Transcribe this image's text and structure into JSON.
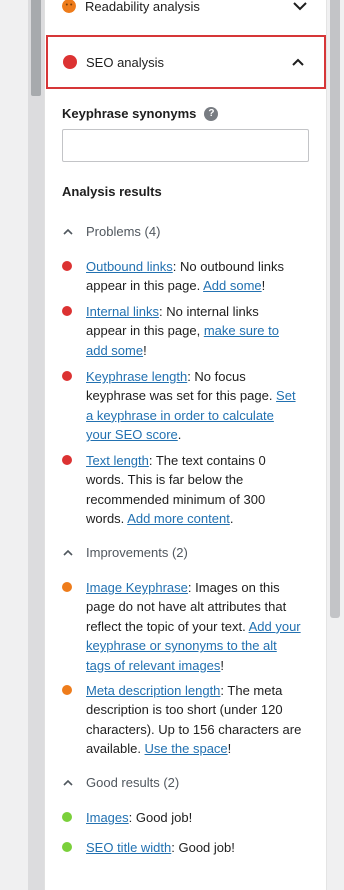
{
  "colors": {
    "problem": "#dc3232",
    "improvement": "#ee7c1b",
    "good": "#7ad03a",
    "link": "#2271b1",
    "focus_border": "#d63638"
  },
  "readability": {
    "title": "Readability analysis",
    "icon": "emoji-face-icon",
    "chevron": "chevron-down-icon"
  },
  "seo": {
    "title": "SEO analysis",
    "chevron": "chevron-up-icon"
  },
  "synonyms": {
    "label": "Keyphrase synonyms",
    "help": "?",
    "value": ""
  },
  "results": {
    "heading": "Analysis results"
  },
  "problems": {
    "header": "Problems (4)",
    "items": [
      {
        "link": "Outbound links",
        "t1": ": No outbound links appear in this page. ",
        "link2": "Add some",
        "t2": "!"
      },
      {
        "link": "Internal links",
        "t1": ": No internal links appear in this page, ",
        "link2": "make sure to add some",
        "t2": "!"
      },
      {
        "link": "Keyphrase length",
        "t1": ": No focus keyphrase was set for this page. ",
        "link2": "Set a keyphrase in order to calculate your SEO score",
        "t2": "."
      },
      {
        "link": "Text length",
        "t1": ": The text contains 0 words. This is far below the recommended minimum of 300 words. ",
        "link2": "Add more content",
        "t2": "."
      }
    ]
  },
  "improvements": {
    "header": "Improvements (2)",
    "items": [
      {
        "link": "Image Keyphrase",
        "t1": ": Images on this page do not have alt attributes that reflect the topic of your text. ",
        "link2": "Add your keyphrase or synonyms to the alt tags of relevant images",
        "t2": "!"
      },
      {
        "link": "Meta description length",
        "t1": ": The meta description is too short (under 120 characters). Up to 156 characters are available. ",
        "link2": "Use the space",
        "t2": "!"
      }
    ]
  },
  "good": {
    "header": "Good results (2)",
    "items": [
      {
        "link": "Images",
        "t1": ": Good job!"
      },
      {
        "link": "SEO title width",
        "t1": ": Good job!"
      }
    ]
  }
}
